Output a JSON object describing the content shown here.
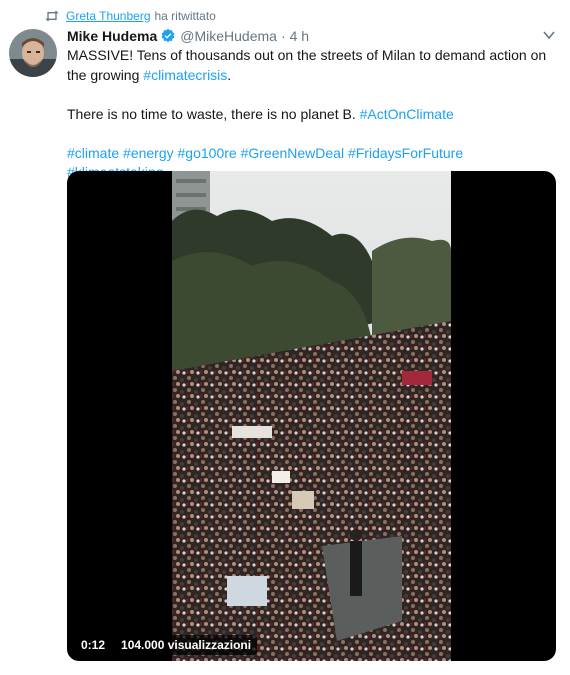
{
  "retweet": {
    "user": "Greta Thunberg",
    "action": "ha ritwittato",
    "icon": "retweet-icon"
  },
  "tweet": {
    "author_name": "Mike Hudema",
    "author_handle": "@MikeHudema",
    "separator": "·",
    "time": "4 h",
    "verified_icon": "verified-badge-icon",
    "line1_a": "MASSIVE! Tens of thousands out on the streets of Milan to demand action on the growing ",
    "line1_tag": "#climatecrisis",
    "line1_b": ".",
    "line2_a": "There is no time to waste, there is no planet B. ",
    "line2_tag": "#ActOnClimate",
    "hashtags": [
      "#climate",
      "#energy",
      "#go100re",
      "#GreenNewDeal",
      "#FridaysForFuture",
      "#klimaatstaking"
    ]
  },
  "video": {
    "duration": "0:12",
    "views": "104.000 visualizzazioni"
  },
  "colors": {
    "link": "#1da1f2",
    "secondary": "#657786",
    "text": "#14171a"
  }
}
